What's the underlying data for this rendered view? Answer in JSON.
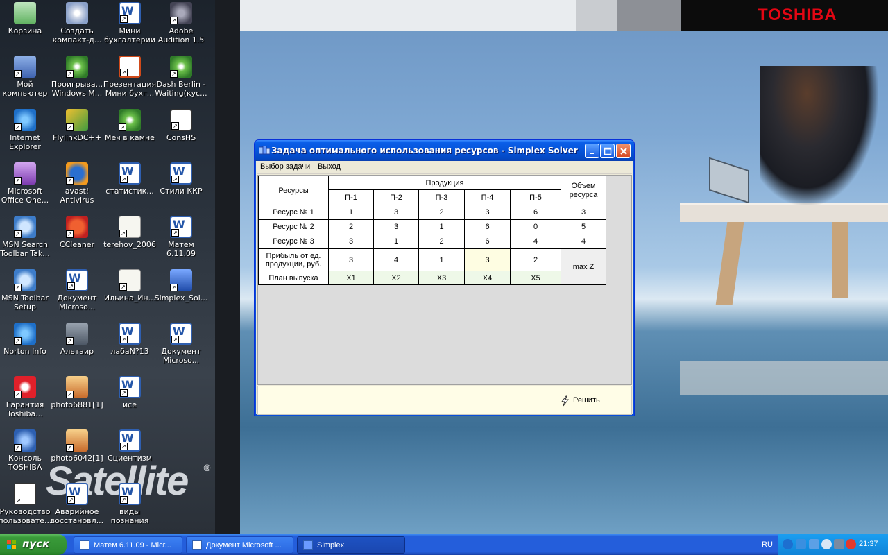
{
  "brand": {
    "toshiba": "TOSHIBA",
    "satellite": "Satellite",
    "registered": "®"
  },
  "desktop_icons": [
    {
      "label": "Корзина",
      "icon": "recycle-bin-icon"
    },
    {
      "label": "Создать\nкомпакт-д...",
      "icon": "cd-burn-icon"
    },
    {
      "label": "Мини\nбухгалтерии",
      "icon": "word-doc-icon"
    },
    {
      "label": "Adobe\nAudition 1.5",
      "icon": "adobe-audition-icon"
    },
    {
      "label": "Мой\nкомпьютер",
      "icon": "my-computer-icon"
    },
    {
      "label": "Проигрыва...\nWindows M...",
      "icon": "media-player-icon"
    },
    {
      "label": "Презентация\nМини бухг...",
      "icon": "powerpoint-icon"
    },
    {
      "label": "Dash Berlin -\nWaiting(кус...",
      "icon": "media-file-icon"
    },
    {
      "label": "Internet\nExplorer",
      "icon": "internet-explorer-icon"
    },
    {
      "label": "FlylinkDC++",
      "icon": "flylink-icon"
    },
    {
      "label": "Меч в камне",
      "icon": "media-file-icon"
    },
    {
      "label": "ConsHS",
      "icon": "console-window-icon"
    },
    {
      "label": "Microsoft\nOffice One...",
      "icon": "onenote-icon"
    },
    {
      "label": "avast!\nAntivirus",
      "icon": "avast-icon"
    },
    {
      "label": "статистик...",
      "icon": "word-doc-icon"
    },
    {
      "label": "Стили ККР",
      "icon": "word-doc-icon"
    },
    {
      "label": "MSN Search\nToolbar Tak...",
      "icon": "msn-search-icon"
    },
    {
      "label": "CCleaner",
      "icon": "ccleaner-icon"
    },
    {
      "label": "terehov_2006",
      "icon": "text-doc-icon"
    },
    {
      "label": "Матем\n6.11.09",
      "icon": "word-doc-icon"
    },
    {
      "label": "MSN Toolbar\nSetup",
      "icon": "msn-search-icon"
    },
    {
      "label": "Документ\nMicroso...",
      "icon": "word-doc-icon"
    },
    {
      "label": "Ильина_Ин...",
      "icon": "text-doc-icon"
    },
    {
      "label": "Simplex_Sol...",
      "icon": "simplex-app-icon"
    },
    {
      "label": "Norton Info",
      "icon": "norton-info-icon"
    },
    {
      "label": "Альтаир",
      "icon": "altair-icon"
    },
    {
      "label": "лабаN?13",
      "icon": "word-doc-icon"
    },
    {
      "label": "Документ\nMicroso...",
      "icon": "word-doc-icon"
    },
    {
      "label": "Гарантия\nToshiba...",
      "icon": "guarantee-icon"
    },
    {
      "label": "photo6881[1]",
      "icon": "photo-icon"
    },
    {
      "label": "исе",
      "icon": "word-doc-icon"
    },
    {
      "label": "Консоль\nTOSHIBA",
      "icon": "toshiba-console-icon"
    },
    {
      "label": "photo6042[1]",
      "icon": "photo-icon"
    },
    {
      "label": "Сциентизм",
      "icon": "word-doc-icon"
    },
    {
      "label": "Руководство\nпользовате...",
      "icon": "user-guide-icon"
    },
    {
      "label": "Аварийное\nвосстановл...",
      "icon": "word-doc-icon"
    },
    {
      "label": "виды\nпознания",
      "icon": "word-doc-icon"
    }
  ],
  "window": {
    "title": "Задача оптимального использования ресурсов  - Simplex Solver",
    "menu": [
      "Выбор задачи",
      "Выход"
    ],
    "table": {
      "resources_header": "Ресурсы",
      "products_header": "Продукция",
      "volume_header": "Объем\nресурса",
      "products": [
        "П-1",
        "П-2",
        "П-3",
        "П-4",
        "П-5"
      ],
      "resource_rows": [
        {
          "name": "Ресурс № 1",
          "values": [
            "1",
            "3",
            "2",
            "3",
            "6"
          ],
          "volume": "3"
        },
        {
          "name": "Ресурс № 2",
          "values": [
            "2",
            "3",
            "1",
            "6",
            "0"
          ],
          "volume": "5"
        },
        {
          "name": "Ресурс № 3",
          "values": [
            "3",
            "1",
            "2",
            "6",
            "4"
          ],
          "volume": "4"
        }
      ],
      "profit_row": {
        "name": "Прибыль от ед.\nпродукции, руб.",
        "values": [
          "3",
          "4",
          "1",
          "3",
          "2"
        ]
      },
      "plan_row": {
        "name": "План выпуска",
        "values": [
          "X1",
          "X2",
          "X3",
          "X4",
          "X5"
        ]
      },
      "objective": "max Z"
    },
    "solve_button": "Решить"
  },
  "taskbar": {
    "start_label": "пуск",
    "tasks": [
      {
        "label": "Матем 6.11.09 - Micr...",
        "active": false
      },
      {
        "label": "Документ Microsoft ...",
        "active": false
      },
      {
        "label": "Simplex",
        "active": true
      }
    ],
    "language": "RU",
    "clock": "21:37"
  }
}
